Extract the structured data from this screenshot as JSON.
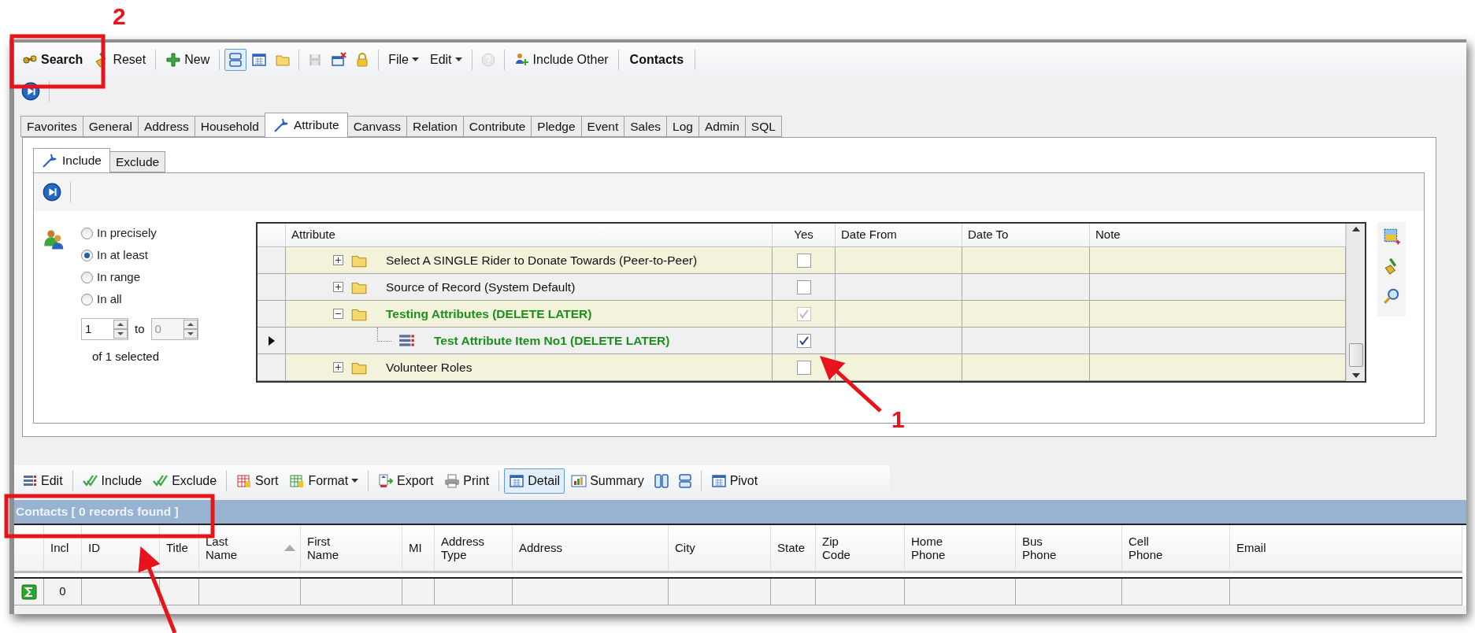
{
  "annotations": [
    {
      "label": "2"
    },
    {
      "label": "1"
    }
  ],
  "toolbar": [
    {
      "kind": "primary",
      "label": "Search"
    },
    {
      "kind": "button",
      "label": "Reset"
    },
    {
      "kind": "separator"
    },
    {
      "kind": "button",
      "label": "New"
    },
    {
      "kind": "separator"
    },
    {
      "kind": "icon",
      "pressed": true,
      "disabled": false
    },
    {
      "kind": "icon",
      "pressed": false,
      "disabled": false
    },
    {
      "kind": "icon",
      "pressed": false,
      "disabled": false
    },
    {
      "kind": "separator"
    },
    {
      "kind": "icon",
      "pressed": false,
      "disabled": true
    },
    {
      "kind": "icon",
      "pressed": false,
      "disabled": false
    },
    {
      "kind": "icon",
      "pressed": false,
      "disabled": false
    },
    {
      "kind": "separator"
    },
    {
      "kind": "dropdown",
      "label": "File"
    },
    {
      "kind": "dropdown",
      "label": "Edit"
    },
    {
      "kind": "separator"
    },
    {
      "kind": "icon",
      "pressed": false,
      "disabled": true
    },
    {
      "kind": "separator"
    },
    {
      "kind": "button",
      "label": "Include Other"
    },
    {
      "kind": "separator"
    },
    {
      "kind": "heading",
      "label": "Contacts"
    }
  ],
  "tabs": [
    {
      "label": "Favorites",
      "selected": false
    },
    {
      "label": "General",
      "selected": false
    },
    {
      "label": "Address",
      "selected": false
    },
    {
      "label": "Household",
      "selected": false
    },
    {
      "label": "Attribute",
      "selected": true
    },
    {
      "label": "Canvass",
      "selected": false
    },
    {
      "label": "Relation",
      "selected": false
    },
    {
      "label": "Contribute",
      "selected": false
    },
    {
      "label": "Pledge",
      "selected": false
    },
    {
      "label": "Event",
      "selected": false
    },
    {
      "label": "Sales",
      "selected": false
    },
    {
      "label": "Log",
      "selected": false
    },
    {
      "label": "Admin",
      "selected": false
    },
    {
      "label": "SQL",
      "selected": false
    }
  ],
  "subtabs": [
    {
      "label": "Include",
      "selected": true
    },
    {
      "label": "Exclude",
      "selected": false
    }
  ],
  "match_mode": [
    {
      "label": "In precisely",
      "selected": false
    },
    {
      "label": "In at least",
      "selected": true
    },
    {
      "label": "In range",
      "selected": false
    },
    {
      "label": "In all",
      "selected": false
    }
  ],
  "range": {
    "from": {
      "value": "1",
      "disabled": false
    },
    "to_label": "to",
    "to": {
      "value": "0",
      "disabled": true
    },
    "summary": "of 1 selected"
  },
  "attribute_grid": {
    "columns": [
      "Attribute",
      "Yes",
      "Date From",
      "Date To",
      "Note"
    ],
    "rows": [
      {
        "kind": "folder",
        "label": "Select A SINGLE Rider to Donate Towards (Peer-to-Peer)",
        "expanded": false,
        "included": false,
        "checked": false,
        "disabled": false,
        "current": false
      },
      {
        "kind": "folder",
        "label": "Source of Record (System Default)",
        "expanded": false,
        "included": false,
        "checked": false,
        "disabled": false,
        "current": false
      },
      {
        "kind": "folder",
        "label": "Testing Attributes (DELETE LATER)",
        "expanded": true,
        "included": true,
        "checked": true,
        "disabled": true,
        "current": false,
        "children": [
          {
            "kind": "item",
            "label": "Test Attribute Item No1 (DELETE LATER)",
            "included": true,
            "checked": true,
            "disabled": false,
            "current": true
          }
        ]
      },
      {
        "kind": "folder",
        "label": "Volunteer Roles",
        "expanded": false,
        "included": false,
        "checked": false,
        "disabled": false,
        "current": false
      }
    ]
  },
  "results_toolbar": [
    {
      "kind": "button",
      "label": "Edit",
      "pressed": false
    },
    {
      "kind": "separator"
    },
    {
      "kind": "button",
      "label": "Include",
      "pressed": false
    },
    {
      "kind": "button",
      "label": "Exclude",
      "pressed": false
    },
    {
      "kind": "separator"
    },
    {
      "kind": "button",
      "label": "Sort",
      "pressed": false
    },
    {
      "kind": "dropdown",
      "label": "Format",
      "pressed": false
    },
    {
      "kind": "separator"
    },
    {
      "kind": "button",
      "label": "Export",
      "pressed": false
    },
    {
      "kind": "button",
      "label": "Print",
      "pressed": false
    },
    {
      "kind": "separator"
    },
    {
      "kind": "button",
      "label": "Detail",
      "pressed": true
    },
    {
      "kind": "button",
      "label": "Summary",
      "pressed": false
    },
    {
      "kind": "icon",
      "pressed": false,
      "disabled": false
    },
    {
      "kind": "icon",
      "pressed": false,
      "disabled": false
    },
    {
      "kind": "separator"
    },
    {
      "kind": "button",
      "label": "Pivot",
      "pressed": false
    }
  ],
  "results": {
    "title": "Contacts [ 0 records found ]",
    "columns": [
      {
        "label": "Incl",
        "sorted": false
      },
      {
        "label": "ID",
        "sorted": false
      },
      {
        "label": "Title",
        "sorted": false
      },
      {
        "label": "Last\nName",
        "sorted": true
      },
      {
        "label": "First\nName",
        "sorted": false
      },
      {
        "label": "MI",
        "sorted": false
      },
      {
        "label": "Address\nType",
        "sorted": false
      },
      {
        "label": "Address",
        "sorted": false
      },
      {
        "label": "City",
        "sorted": false
      },
      {
        "label": "State",
        "sorted": false
      },
      {
        "label": "Zip\nCode",
        "sorted": false
      },
      {
        "label": "Home\nPhone",
        "sorted": false
      },
      {
        "label": "Bus\nPhone",
        "sorted": false
      },
      {
        "label": "Cell\nPhone",
        "sorted": false
      },
      {
        "label": "Email",
        "sorted": false
      }
    ],
    "totals": [
      "0"
    ]
  }
}
